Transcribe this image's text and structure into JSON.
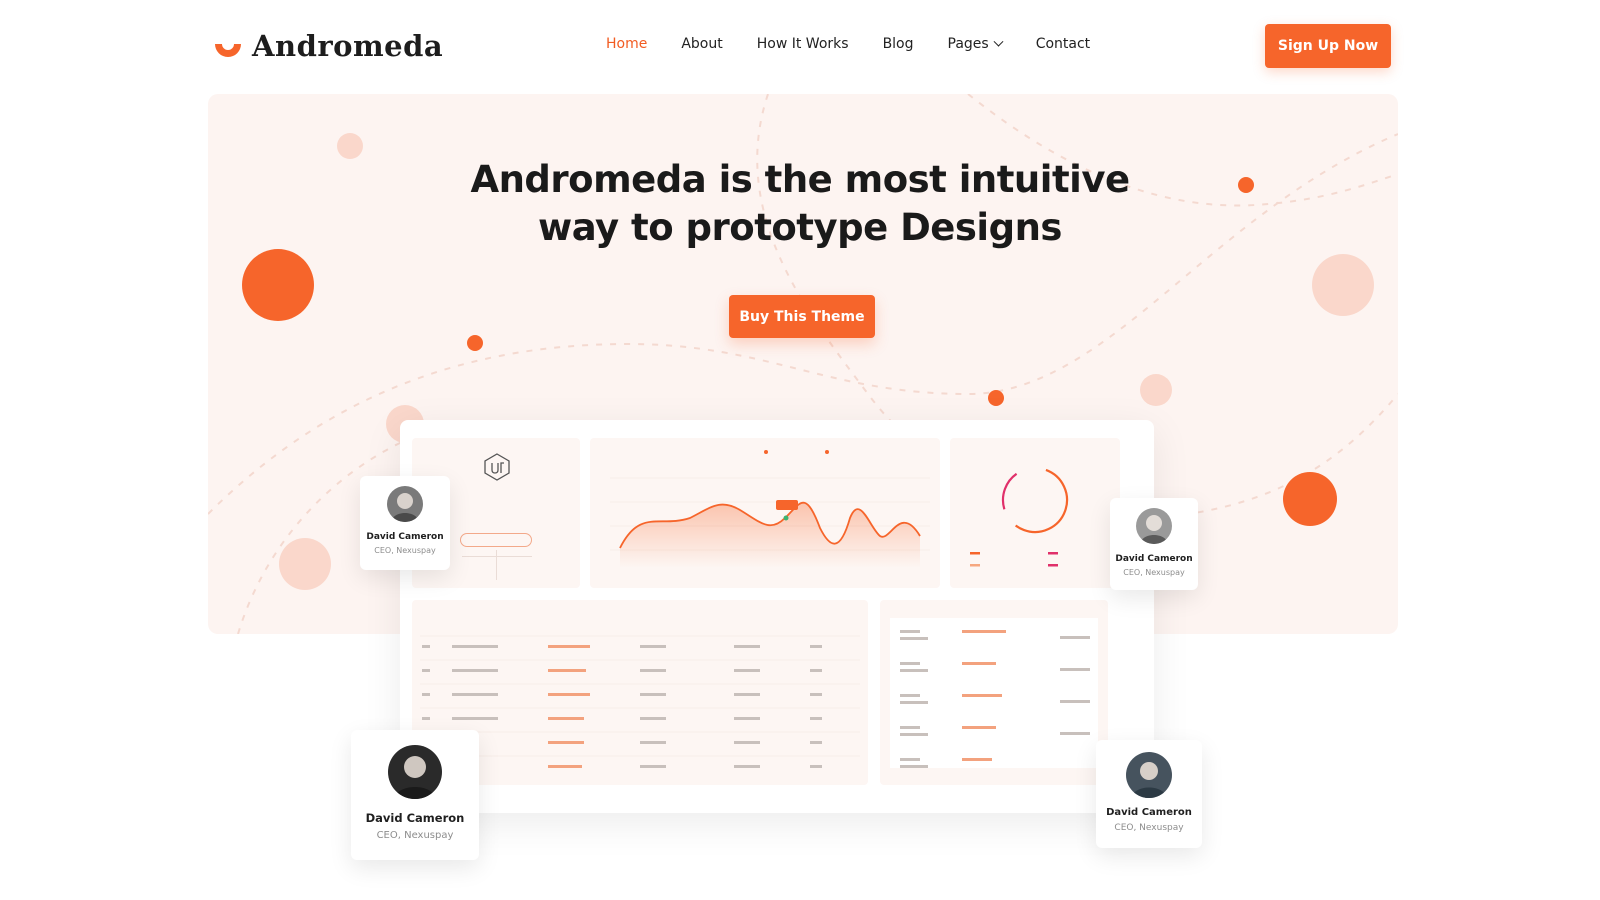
{
  "brand": {
    "name": "Andromeda",
    "accent": "#f6652b"
  },
  "nav": {
    "items": [
      {
        "label": "Home",
        "active": true
      },
      {
        "label": "About"
      },
      {
        "label": "How It Works"
      },
      {
        "label": "Blog"
      },
      {
        "label": "Pages",
        "has_dropdown": true
      },
      {
        "label": "Contact"
      }
    ],
    "cta_label": "Sign Up Now"
  },
  "hero": {
    "title_line1": "Andromeda is the most intuitive",
    "title_line2": "way to prototype Designs",
    "cta_label": "Buy This Theme"
  },
  "profiles": [
    {
      "name": "David Cameron",
      "role": "CEO, Nexuspay"
    },
    {
      "name": "David Cameron",
      "role": "CEO, Nexuspay"
    },
    {
      "name": "David Cameron",
      "role": "CEO, Nexuspay"
    },
    {
      "name": "David Cameron",
      "role": "CEO, Nexuspay"
    }
  ]
}
